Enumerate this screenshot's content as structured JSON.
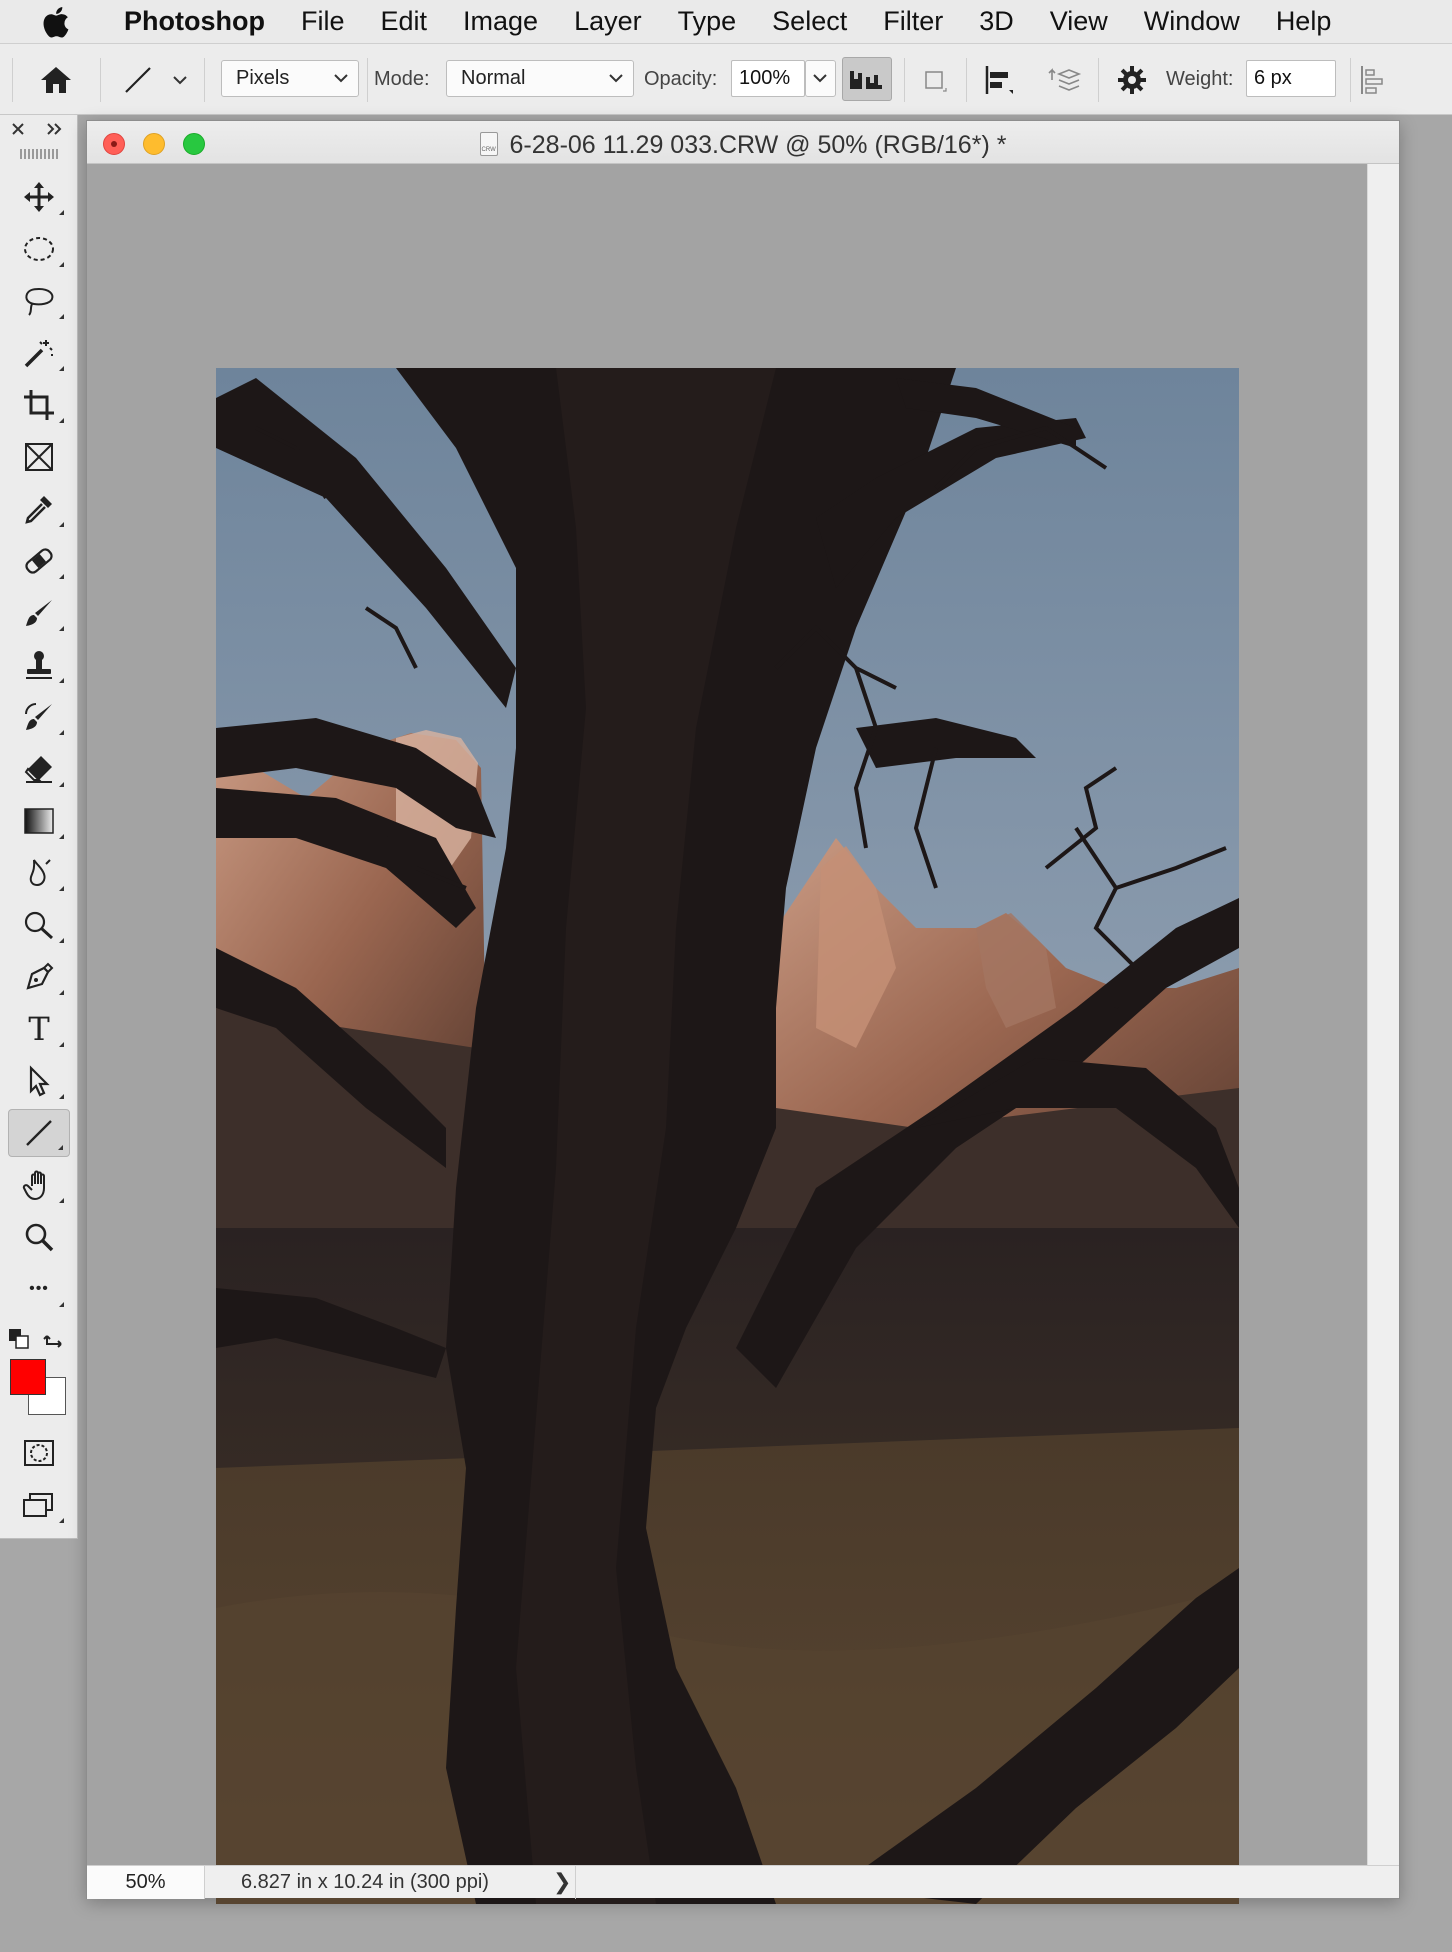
{
  "menubar": {
    "app_name": "Photoshop",
    "items": [
      "File",
      "Edit",
      "Image",
      "Layer",
      "Type",
      "Select",
      "Filter",
      "3D",
      "View",
      "Window",
      "Help"
    ]
  },
  "options_bar": {
    "tool_mode": "Pixels",
    "mode_label": "Mode:",
    "mode_value": "Normal",
    "opacity_label": "Opacity:",
    "opacity_value": "100%",
    "weight_label": "Weight:",
    "weight_value": "6 px"
  },
  "tools": [
    {
      "name": "move-tool",
      "icon": "move-icon"
    },
    {
      "name": "marquee-tool",
      "icon": "marquee-icon"
    },
    {
      "name": "lasso-tool",
      "icon": "lasso-icon"
    },
    {
      "name": "magic-wand-tool",
      "icon": "magic-wand-icon"
    },
    {
      "name": "crop-tool",
      "icon": "crop-icon"
    },
    {
      "name": "frame-tool",
      "icon": "frame-icon"
    },
    {
      "name": "eyedropper-tool",
      "icon": "eyedropper-icon"
    },
    {
      "name": "healing-brush-tool",
      "icon": "bandage-icon"
    },
    {
      "name": "brush-tool",
      "icon": "brush-icon"
    },
    {
      "name": "clone-stamp-tool",
      "icon": "stamp-icon"
    },
    {
      "name": "history-brush-tool",
      "icon": "history-brush-icon"
    },
    {
      "name": "eraser-tool",
      "icon": "eraser-icon"
    },
    {
      "name": "gradient-tool",
      "icon": "gradient-icon"
    },
    {
      "name": "blur-tool",
      "icon": "blur-icon"
    },
    {
      "name": "dodge-tool",
      "icon": "dodge-icon"
    },
    {
      "name": "pen-tool",
      "icon": "pen-icon"
    },
    {
      "name": "type-tool",
      "icon": "type-icon",
      "glyph": "T"
    },
    {
      "name": "path-selection-tool",
      "icon": "arrow-icon"
    },
    {
      "name": "line-tool",
      "icon": "line-icon",
      "active": true
    },
    {
      "name": "hand-tool",
      "icon": "hand-icon"
    },
    {
      "name": "zoom-tool",
      "icon": "zoom-icon"
    },
    {
      "name": "more-tools",
      "icon": "ellipsis-icon",
      "glyph": "•••"
    }
  ],
  "colors": {
    "foreground": "#ff0000",
    "background": "#ffffff",
    "close": "#ff5f57",
    "minimize": "#febc2e",
    "zoom": "#28c840"
  },
  "document": {
    "title": "6-28-06 11.29 033.CRW @ 50% (RGB/16*) *",
    "file_badge": "CRW"
  },
  "statusbar": {
    "zoom": "50%",
    "info": "6.827 in x 10.24 in (300 ppi)",
    "arrow": "❯"
  }
}
